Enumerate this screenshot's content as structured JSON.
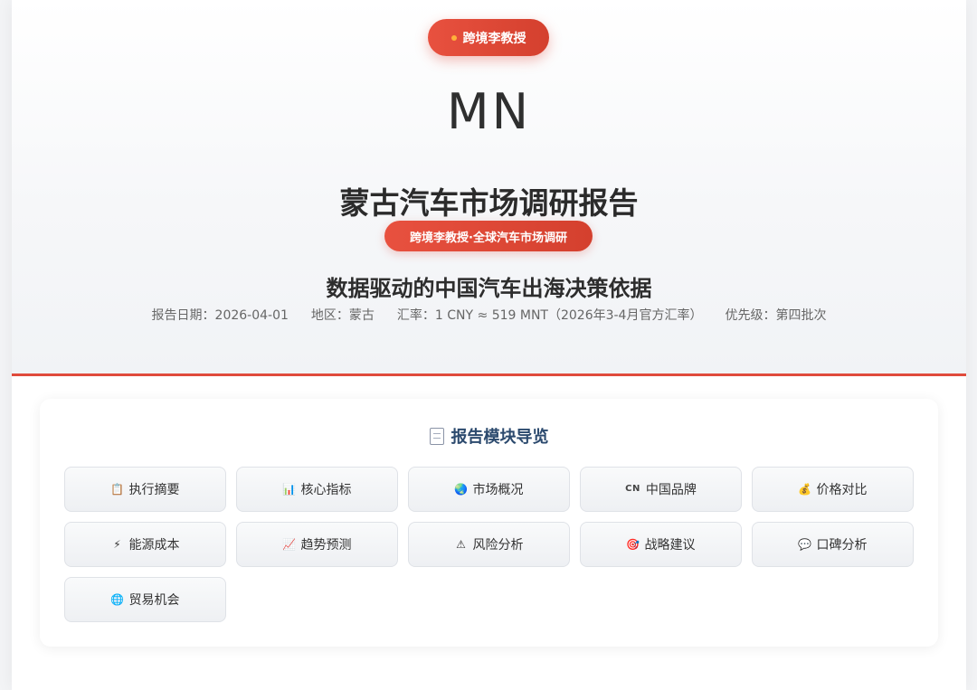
{
  "brand": {
    "label": "跨境李教授"
  },
  "hero": {
    "country_code": "MN",
    "title": "蒙古汽车市场调研报告",
    "subtitle_pill": "跨境李教授·全球汽车市场调研",
    "tagline": "数据驱动的中国汽车出海决策依据",
    "meta": {
      "report_date": "报告日期：2026-04-01",
      "region": "地区：蒙古",
      "exchange_rate": "汇率：1 CNY ≈ 519 MNT（2026年3-4月官方汇率）",
      "priority": "优先级：第四批次"
    }
  },
  "colors": {
    "accent": "#e04b3c",
    "nav_title": "#2c4a6e"
  },
  "nav": {
    "title": "报告模块导览",
    "title_icon": "document-icon",
    "items": [
      {
        "label": "执行摘要",
        "icon": "clipboard-icon",
        "glyph": "📋"
      },
      {
        "label": "核心指标",
        "icon": "bar-chart-icon",
        "glyph": "📊"
      },
      {
        "label": "市场概况",
        "icon": "globe-icon",
        "glyph": "🌏"
      },
      {
        "label": "中国品牌",
        "icon": "cn-flag-icon",
        "glyph": "CN"
      },
      {
        "label": "价格对比",
        "icon": "money-bag-icon",
        "glyph": "💰"
      },
      {
        "label": "能源成本",
        "icon": "lightning-icon",
        "glyph": "⚡"
      },
      {
        "label": "趋势预测",
        "icon": "trend-chart-icon",
        "glyph": "📈"
      },
      {
        "label": "风险分析",
        "icon": "warning-icon",
        "glyph": "⚠"
      },
      {
        "label": "战略建议",
        "icon": "target-icon",
        "glyph": "🎯"
      },
      {
        "label": "口碑分析",
        "icon": "speech-bubble-icon",
        "glyph": "💬"
      },
      {
        "label": "贸易机会",
        "icon": "globe-network-icon",
        "glyph": "🌐"
      }
    ]
  }
}
